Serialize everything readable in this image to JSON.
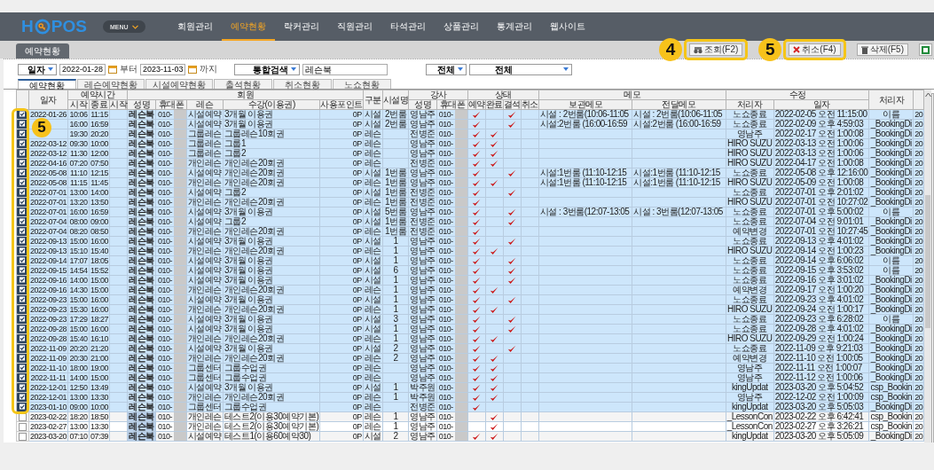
{
  "logo": {
    "prefix": "H",
    "suffix": "POS"
  },
  "menu_button": "MENU",
  "nav": [
    {
      "label": "회원관리",
      "selected": false
    },
    {
      "label": "예약현황",
      "selected": true
    },
    {
      "label": "락커관리",
      "selected": false
    },
    {
      "label": "직원관리",
      "selected": false
    },
    {
      "label": "타석관리",
      "selected": false
    },
    {
      "label": "상품관리",
      "selected": false
    },
    {
      "label": "통계관리",
      "selected": false
    },
    {
      "label": "웹사이트",
      "selected": false
    }
  ],
  "page_tab": "예약현황",
  "toolbar": [
    {
      "kind": "search",
      "label": "조회(F2)"
    },
    {
      "kind": "cancel",
      "label": "취소(F4)"
    },
    {
      "kind": "delete",
      "label": "삭제(F5)"
    },
    {
      "kind": "excel"
    }
  ],
  "filter": {
    "date_type": "일자",
    "from": "2022-01-28",
    "from_suffix": "부터",
    "to": "2023-11-03",
    "to_suffix": "까지",
    "search_type": "통합검색",
    "search_value": "레슨북",
    "filter_1": "전체",
    "filter_2": "전체"
  },
  "sub_tabs": [
    {
      "label": "예약현황",
      "selected": true
    },
    {
      "label": "레슨예약현황",
      "selected": false
    },
    {
      "label": "시설예약현황",
      "selected": false
    },
    {
      "label": "출석현황",
      "selected": false
    },
    {
      "label": "취소현황",
      "selected": false
    },
    {
      "label": "노쇼현황",
      "selected": false
    }
  ],
  "columns": {
    "date": "일자",
    "time_group": "예약시간",
    "time": [
      "시작",
      "종료",
      "시작"
    ],
    "member_group": "회원",
    "member": [
      "성명",
      "휴대폰",
      "레슨",
      "수강(이용권)",
      "사용포인트"
    ],
    "type": "구분",
    "facility": "시설명",
    "coach_group": "강사",
    "coach": [
      "성명",
      "휴대폰"
    ],
    "status_group": "상태",
    "status": [
      "예약",
      "완료",
      "결석",
      "취소"
    ],
    "memo_group": "메모",
    "memo": [
      "보관메모",
      "전달메모"
    ],
    "edit_group": "수정",
    "edit": [
      "처리자",
      "일자"
    ],
    "handler": "처리자"
  },
  "rows": [
    {
      "selected": true,
      "date": "2022-01-26",
      "start": "10:06",
      "end": "11:15",
      "name": "레슨북",
      "phone": "010-",
      "lesson": "시설예약",
      "pass": "3개월 이용권",
      "points": "0P",
      "type": "시설",
      "facility": "2번룸",
      "coach": "영남주",
      "coach_phone": "010-",
      "reserved": true,
      "done": false,
      "absent": true,
      "cancelled": false,
      "memo_keep": "시설 : 2번룸(10:06-11:05",
      "memo_send": "시설 : 2번룸(10:06-11:05",
      "handler": "노쇼종료",
      "modified": "2022-02-05 오전 11:15:00",
      "handler_2": "이름",
      "column_22": "20"
    },
    {
      "selected": true,
      "start": "16:00",
      "end": "16:59",
      "name": "레슨북",
      "phone": "010-",
      "lesson": "시설예약",
      "pass": "3개월 이용권",
      "points": "0P",
      "type": "시설",
      "facility": "2번룸",
      "coach": "영남주",
      "coach_phone": "010-",
      "reserved": true,
      "done": false,
      "absent": true,
      "cancelled": false,
      "memo_keep": "시설:2번룸 (16:00-16:59",
      "memo_send": "시설:2번룸 (16:00-16:59",
      "handler": "노쇼종료",
      "modified": "2022-02-09 오후 4:59:03",
      "handler_2": "_BookingDi",
      "column_22": "20"
    },
    {
      "selected": true,
      "start": "19:30",
      "end": "20:20",
      "name": "레슨북",
      "phone": "010-",
      "lesson": "그룹레슨",
      "pass": "그룹레슨10회권",
      "points": "0P",
      "type": "레슨",
      "coach": "전병준",
      "coach_phone": "010-",
      "reserved": true,
      "done": true,
      "absent": false,
      "cancelled": false,
      "handler": "영남주",
      "modified": "2022-02-17 오전 1:00:08",
      "handler_2": "_BookingDi",
      "column_22": "20"
    },
    {
      "selected": true,
      "date": "2022-03-12",
      "start": "09:30",
      "end": "10:00",
      "name": "레슨북",
      "phone": "010-",
      "lesson": "그룹레슨",
      "pass": "그룹1",
      "points": "0P",
      "type": "레슨",
      "coach": "영남주",
      "coach_phone": "010-",
      "reserved": true,
      "done": true,
      "absent": false,
      "cancelled": false,
      "handler": "HIRO SUZU",
      "modified": "2022-03-13 오전 1:00:06",
      "handler_2": "_BookingDi",
      "column_22": "20"
    },
    {
      "selected": true,
      "date": "2022-03-12",
      "start": "11:30",
      "end": "12:00",
      "name": "레슨북",
      "phone": "010-",
      "lesson": "그룹레슨",
      "pass": "그룹2",
      "points": "0P",
      "type": "레슨",
      "coach": "영남주",
      "coach_phone": "010-",
      "reserved": true,
      "done": true,
      "absent": false,
      "cancelled": false,
      "handler": "HIRO SUZU",
      "modified": "2022-03-13 오전 1:00:06",
      "handler_2": "_BookingDi",
      "column_22": "20"
    },
    {
      "selected": true,
      "date": "2022-04-16",
      "start": "07:20",
      "end": "07:50",
      "name": "레슨북",
      "phone": "010-",
      "lesson": "개인레슨",
      "pass": "개인레슨20회권",
      "points": "0P",
      "type": "레슨",
      "coach": "전병준",
      "coach_phone": "010-",
      "reserved": true,
      "done": true,
      "absent": false,
      "cancelled": false,
      "handler": "HIRO SUZU",
      "modified": "2022-04-17 오전 1:00:08",
      "handler_2": "_BookingDi",
      "column_22": "20"
    },
    {
      "selected": true,
      "date": "2022-05-08",
      "start": "11:10",
      "end": "12:15",
      "name": "레슨북",
      "phone": "010-",
      "lesson": "시설예약",
      "pass": "개인레슨20회권",
      "points": "0P",
      "type": "시설",
      "facility": "1번룸",
      "coach": "영남주",
      "coach_phone": "010-",
      "reserved": true,
      "done": false,
      "absent": true,
      "cancelled": false,
      "memo_keep": "시설:1번룸 (11:10-12:15",
      "memo_send": "시설:1번룸 (11:10-12:15",
      "handler": "노쇼종료",
      "modified": "2022-05-08 오후 12:16:00",
      "handler_2": "_BookingDi",
      "column_22": "20"
    },
    {
      "selected": true,
      "date": "2022-05-08",
      "start": "11:15",
      "end": "11:45",
      "name": "레슨북",
      "phone": "010-",
      "lesson": "개인레슨",
      "pass": "개인레슨20회권",
      "points": "0P",
      "type": "레슨",
      "facility": "1번룸",
      "coach": "영남주",
      "coach_phone": "010-",
      "reserved": true,
      "done": true,
      "absent": false,
      "cancelled": false,
      "memo_keep": "시설:1번룸 (11:10-12:15",
      "memo_send": "시설:1번룸 (11:10-12:15",
      "handler": "HIRO SUZU",
      "modified": "2022-05-09 오전 1:00:08",
      "handler_2": "_BookingDi",
      "column_22": "20"
    },
    {
      "selected": true,
      "date": "2022-07-01",
      "start": "13:00",
      "end": "14:00",
      "name": "레슨북",
      "phone": "010-",
      "lesson": "시설예약",
      "pass": "그룹2",
      "points": "0P",
      "type": "시설",
      "facility": "1번룸",
      "coach": "전병준",
      "coach_phone": "010-",
      "reserved": true,
      "done": false,
      "absent": true,
      "cancelled": false,
      "handler": "노쇼종료",
      "modified": "2022-07-01 오후 2:01:02",
      "handler_2": "_BookingDi",
      "column_22": "20"
    },
    {
      "selected": true,
      "date": "2022-07-01",
      "start": "13:20",
      "end": "13:50",
      "name": "레슨북",
      "phone": "010-",
      "lesson": "개인레슨",
      "pass": "개인레슨20회권",
      "points": "0P",
      "type": "레슨",
      "facility": "1번룸",
      "coach": "전병준",
      "coach_phone": "010-",
      "reserved": true,
      "done": false,
      "absent": false,
      "cancelled": false,
      "handler": "HIRO SUZU",
      "modified": "2022-07-01 오전 10:27:02",
      "handler_2": "_BookingDi",
      "column_22": "20"
    },
    {
      "selected": true,
      "date": "2022-07-01",
      "start": "16:00",
      "end": "16:59",
      "name": "레슨북",
      "phone": "010-",
      "lesson": "시설예약",
      "pass": "3개월 이용권",
      "points": "0P",
      "type": "시설",
      "facility": "5번룸",
      "coach": "영남주",
      "coach_phone": "010-",
      "reserved": true,
      "done": false,
      "absent": true,
      "cancelled": false,
      "memo_keep": "시설 : 3번룸(12:07-13:05",
      "memo_send": "시설 : 3번룸(12:07-13:05",
      "handler": "노쇼종료",
      "modified": "2022-07-01 오후 5:00:02",
      "handler_2": "이름",
      "column_22": "20"
    },
    {
      "selected": true,
      "date": "2022-07-04",
      "start": "08:00",
      "end": "09:00",
      "name": "레슨북",
      "phone": "010-",
      "lesson": "시설예약",
      "pass": "그룹2",
      "points": "0P",
      "type": "시설",
      "facility": "1번룸",
      "coach": "전병준",
      "coach_phone": "010-",
      "reserved": true,
      "done": false,
      "absent": true,
      "cancelled": false,
      "handler": "노쇼종료",
      "modified": "2022-07-04 오전 9:01:01",
      "handler_2": "_BookingDi",
      "column_22": "20"
    },
    {
      "selected": true,
      "date": "2022-07-04",
      "start": "08:20",
      "end": "08:50",
      "name": "레슨북",
      "phone": "010-",
      "lesson": "개인레슨",
      "pass": "개인레슨20회권",
      "points": "0P",
      "type": "레슨",
      "facility": "1번룸",
      "coach": "전병준",
      "coach_phone": "010-",
      "reserved": true,
      "done": false,
      "absent": false,
      "cancelled": false,
      "handler": "예약변경",
      "modified": "2022-07-01 오전 10:27:45",
      "handler_2": "_BookingDi",
      "column_22": "20"
    },
    {
      "selected": true,
      "date": "2022-09-13",
      "start": "15:00",
      "end": "16:00",
      "name": "레슨북",
      "phone": "010-",
      "lesson": "시설예약",
      "pass": "3개월 이용권",
      "points": "0P",
      "type": "시설",
      "facility": "1",
      "coach": "영남주",
      "coach_phone": "010-",
      "reserved": true,
      "done": false,
      "absent": true,
      "cancelled": false,
      "handler": "노쇼종료",
      "modified": "2022-09-13 오후 4:01:02",
      "handler_2": "_BookingDi",
      "column_22": "20"
    },
    {
      "selected": true,
      "date": "2022-09-13",
      "start": "15:10",
      "end": "15:40",
      "name": "레슨북",
      "phone": "010-",
      "lesson": "개인레슨",
      "pass": "개인레슨20회권",
      "points": "0P",
      "type": "레슨",
      "facility": "1",
      "coach": "영남주",
      "coach_phone": "010-",
      "reserved": true,
      "done": true,
      "absent": false,
      "cancelled": false,
      "handler": "HIRO SUZU",
      "modified": "2022-09-14 오전 1:00:23",
      "handler_2": "_BookingDi",
      "column_22": "20"
    },
    {
      "selected": true,
      "date": "2022-09-14",
      "start": "17:07",
      "end": "18:05",
      "name": "레슨북",
      "phone": "010-",
      "lesson": "시설예약",
      "pass": "3개월 이용권",
      "points": "0P",
      "type": "시설",
      "facility": "1",
      "coach": "영남주",
      "coach_phone": "010-",
      "reserved": true,
      "done": false,
      "absent": true,
      "cancelled": false,
      "handler": "노쇼종료",
      "modified": "2022-09-14 오후 6:06:02",
      "handler_2": "이름",
      "column_22": "20"
    },
    {
      "selected": true,
      "date": "2022-09-15",
      "start": "14:54",
      "end": "15:52",
      "name": "레슨북",
      "phone": "010-",
      "lesson": "시설예약",
      "pass": "3개월 이용권",
      "points": "0P",
      "type": "시설",
      "facility": "6",
      "coach": "영남주",
      "coach_phone": "010-",
      "reserved": true,
      "done": false,
      "absent": true,
      "cancelled": false,
      "handler": "노쇼종료",
      "modified": "2022-09-15 오후 3:53:02",
      "handler_2": "이름",
      "column_22": "20"
    },
    {
      "selected": true,
      "date": "2022-09-16",
      "start": "14:00",
      "end": "15:00",
      "name": "레슨북",
      "phone": "010-",
      "lesson": "시설예약",
      "pass": "3개월 이용권",
      "points": "0P",
      "type": "시설",
      "facility": "1",
      "coach": "영남주",
      "coach_phone": "010-",
      "reserved": true,
      "done": false,
      "absent": true,
      "cancelled": false,
      "handler": "노쇼종료",
      "modified": "2022-09-16 오후 3:01:02",
      "handler_2": "_BookingDi",
      "column_22": "20"
    },
    {
      "selected": true,
      "date": "2022-09-16",
      "start": "14:30",
      "end": "15:00",
      "name": "레슨북",
      "phone": "010-",
      "lesson": "개인레슨",
      "pass": "개인레슨20회권",
      "points": "0P",
      "type": "레슨",
      "facility": "1",
      "coach": "영남주",
      "coach_phone": "010-",
      "reserved": true,
      "done": true,
      "absent": false,
      "cancelled": false,
      "handler": "예약변경",
      "modified": "2022-09-17 오전 1:00:20",
      "handler_2": "_BookingDi",
      "column_22": "20"
    },
    {
      "selected": true,
      "date": "2022-09-23",
      "start": "15:00",
      "end": "16:00",
      "name": "레슨북",
      "phone": "010-",
      "lesson": "시설예약",
      "pass": "3개월 이용권",
      "points": "0P",
      "type": "시설",
      "facility": "1",
      "coach": "영남주",
      "coach_phone": "010-",
      "reserved": true,
      "done": false,
      "absent": true,
      "cancelled": false,
      "handler": "노쇼종료",
      "modified": "2022-09-23 오후 4:01:02",
      "handler_2": "_BookingDi",
      "column_22": "20"
    },
    {
      "selected": true,
      "date": "2022-09-23",
      "start": "15:30",
      "end": "16:00",
      "name": "레슨북",
      "phone": "010-",
      "lesson": "개인레슨",
      "pass": "개인레슨20회권",
      "points": "0P",
      "type": "레슨",
      "facility": "1",
      "coach": "영남주",
      "coach_phone": "010-",
      "reserved": true,
      "done": true,
      "absent": false,
      "cancelled": false,
      "handler": "HIRO SUZU",
      "modified": "2022-09-24 오전 1:00:17",
      "handler_2": "_BookingDi",
      "column_22": "20"
    },
    {
      "selected": true,
      "date": "2022-09-23",
      "start": "17:29",
      "end": "18:27",
      "name": "레슨북",
      "phone": "010-",
      "lesson": "시설예약",
      "pass": "3개월 이용권",
      "points": "0P",
      "type": "시설",
      "facility": "3",
      "coach": "영남주",
      "coach_phone": "010-",
      "reserved": true,
      "done": false,
      "absent": true,
      "cancelled": false,
      "handler": "노쇼종료",
      "modified": "2022-09-23 오후 6:28:02",
      "handler_2": "이름",
      "column_22": "20"
    },
    {
      "selected": true,
      "date": "2022-09-28",
      "start": "15:00",
      "end": "16:00",
      "name": "레슨북",
      "phone": "010-",
      "lesson": "시설예약",
      "pass": "3개월 이용권",
      "points": "0P",
      "type": "시설",
      "facility": "1",
      "coach": "영남주",
      "coach_phone": "010-",
      "reserved": true,
      "done": false,
      "absent": true,
      "cancelled": false,
      "handler": "노쇼종료",
      "modified": "2022-09-28 오후 4:01:02",
      "handler_2": "_BookingDi",
      "column_22": "20"
    },
    {
      "selected": true,
      "date": "2022-09-28",
      "start": "15:40",
      "end": "16:10",
      "name": "레슨북",
      "phone": "010-",
      "lesson": "개인레슨",
      "pass": "개인레슨20회권",
      "points": "0P",
      "type": "레슨",
      "facility": "1",
      "coach": "영남주",
      "coach_phone": "010-",
      "reserved": true,
      "done": true,
      "absent": false,
      "cancelled": false,
      "handler": "HIRO SUZU",
      "modified": "2022-09-29 오전 1:00:24",
      "handler_2": "_BookingDi",
      "column_22": "20"
    },
    {
      "selected": true,
      "date": "2022-11-09",
      "start": "20:20",
      "end": "21:20",
      "name": "레슨북",
      "phone": "010-",
      "lesson": "시설예약",
      "pass": "3개월 이용권",
      "points": "0P",
      "type": "시설",
      "facility": "2",
      "coach": "영남주",
      "coach_phone": "010-",
      "reserved": true,
      "done": false,
      "absent": true,
      "cancelled": false,
      "handler": "노쇼종료",
      "modified": "2022-11-09 오후 9:21:03",
      "handler_2": "_BookingDi",
      "column_22": "20"
    },
    {
      "selected": true,
      "date": "2022-11-09",
      "start": "20:30",
      "end": "21:00",
      "name": "레슨북",
      "phone": "010-",
      "lesson": "개인레슨",
      "pass": "개인레슨20회권",
      "points": "0P",
      "type": "레슨",
      "facility": "2",
      "coach": "영남주",
      "coach_phone": "010-",
      "reserved": true,
      "done": true,
      "absent": false,
      "cancelled": false,
      "handler": "예약변경",
      "modified": "2022-11-10 오전 1:00:05",
      "handler_2": "_BookingDi",
      "column_22": "20"
    },
    {
      "selected": true,
      "date": "2022-11-10",
      "start": "18:00",
      "end": "19:00",
      "name": "레슨북",
      "phone": "010-",
      "lesson": "그룹센터",
      "pass": "그룹수업권",
      "points": "0P",
      "type": "레슨",
      "coach": "영남주",
      "coach_phone": "010-",
      "reserved": true,
      "done": true,
      "absent": false,
      "cancelled": false,
      "handler": "영남주",
      "modified": "2022-11-11 오전 1:00:07",
      "handler_2": "_BookingDi",
      "column_22": "20"
    },
    {
      "selected": true,
      "date": "2022-11-11",
      "start": "14:00",
      "end": "15:00",
      "name": "레슨북",
      "phone": "010-",
      "lesson": "그룹센터",
      "pass": "그룹수업권",
      "points": "0P",
      "type": "레슨",
      "coach": "영남주",
      "coach_phone": "010-",
      "reserved": true,
      "done": true,
      "absent": false,
      "cancelled": false,
      "handler": "영남주",
      "modified": "2022-11-12 오전 1:00:06",
      "handler_2": "_BookingDi",
      "column_22": "20"
    },
    {
      "selected": true,
      "date": "2022-12-01",
      "start": "12:50",
      "end": "13:49",
      "name": "레슨북",
      "phone": "010-",
      "lesson": "시설예약",
      "pass": "3개월 이용권",
      "points": "0P",
      "type": "시설",
      "facility": "1",
      "coach": "박주원",
      "coach_phone": "010-",
      "reserved": true,
      "done": true,
      "absent": false,
      "cancelled": false,
      "handler": "kingUpdat",
      "modified": "2023-03-20 오후 5:04:52",
      "handler_2": "csp_Bookin",
      "column_22": "20"
    },
    {
      "selected": true,
      "date": "2022-12-01",
      "start": "13:00",
      "end": "13:30",
      "name": "레슨북",
      "phone": "010-",
      "lesson": "개인레슨",
      "pass": "개인레슨20회권",
      "points": "0P",
      "type": "레슨",
      "facility": "1",
      "coach": "박주원",
      "coach_phone": "010-",
      "reserved": true,
      "done": true,
      "absent": false,
      "cancelled": false,
      "handler": "영남주",
      "modified": "2022-12-02 오전 1:00:09",
      "handler_2": "csp_Bookin",
      "column_22": "20"
    },
    {
      "selected": true,
      "date": "2023-01-10",
      "start": "09:00",
      "end": "10:00",
      "name": "레슨북",
      "phone": "010-",
      "lesson": "그룹센터",
      "pass": "그룹수업권",
      "points": "0P",
      "type": "레슨",
      "coach": "전병준",
      "coach_phone": "010-",
      "reserved": true,
      "done": false,
      "absent": false,
      "cancelled": false,
      "handler": "kingUpdat",
      "modified": "2023-03-20 오후 5:05:03",
      "handler_2": "_BookingDi",
      "column_22": "20"
    },
    {
      "selected": false,
      "date": "2023-02-22",
      "start": "18:20",
      "end": "18:50",
      "name": "레슨북",
      "phone": "010-",
      "lesson": "개인레슨",
      "pass": "테스트2(이용30예약기본)",
      "points": "0P",
      "type": "레슨",
      "facility": "1",
      "coach": "영남주",
      "coach_phone": "010-",
      "reserved": false,
      "done": true,
      "absent": false,
      "cancelled": false,
      "handler": "_LessonCon",
      "modified": "2023-02-22 오후 6:42:41",
      "handler_2": "csp_Bookin",
      "column_22": "20"
    },
    {
      "selected": false,
      "date": "2023-02-27",
      "start": "13:00",
      "end": "13:30",
      "name": "레슨북",
      "phone": "010-",
      "lesson": "개인레슨",
      "pass": "테스트2(이용30예약기본)",
      "points": "0P",
      "type": "레슨",
      "facility": "1",
      "coach": "영남주",
      "coach_phone": "010-",
      "reserved": false,
      "done": true,
      "absent": false,
      "cancelled": false,
      "handler": "_LessonCon",
      "modified": "2023-02-27 오후 3:26:21",
      "handler_2": "csp_Bookin",
      "column_22": "20"
    },
    {
      "selected": false,
      "date": "2023-03-20",
      "start": "07:10",
      "end": "07:39",
      "name": "레슨북",
      "phone": "010-",
      "lesson": "시설예약",
      "pass": "테스트1(이용60예약30)",
      "points": "0P",
      "type": "시설",
      "facility": "2",
      "coach": "영남주",
      "coach_phone": "010-",
      "reserved": true,
      "done": true,
      "absent": false,
      "cancelled": false,
      "handler": "kingUpdat",
      "modified": "2023-03-20 오후 5:05:09",
      "handler_2": "_BookingDi",
      "column_22": "20"
    }
  ],
  "annotations": [
    "4",
    "5",
    "5"
  ]
}
